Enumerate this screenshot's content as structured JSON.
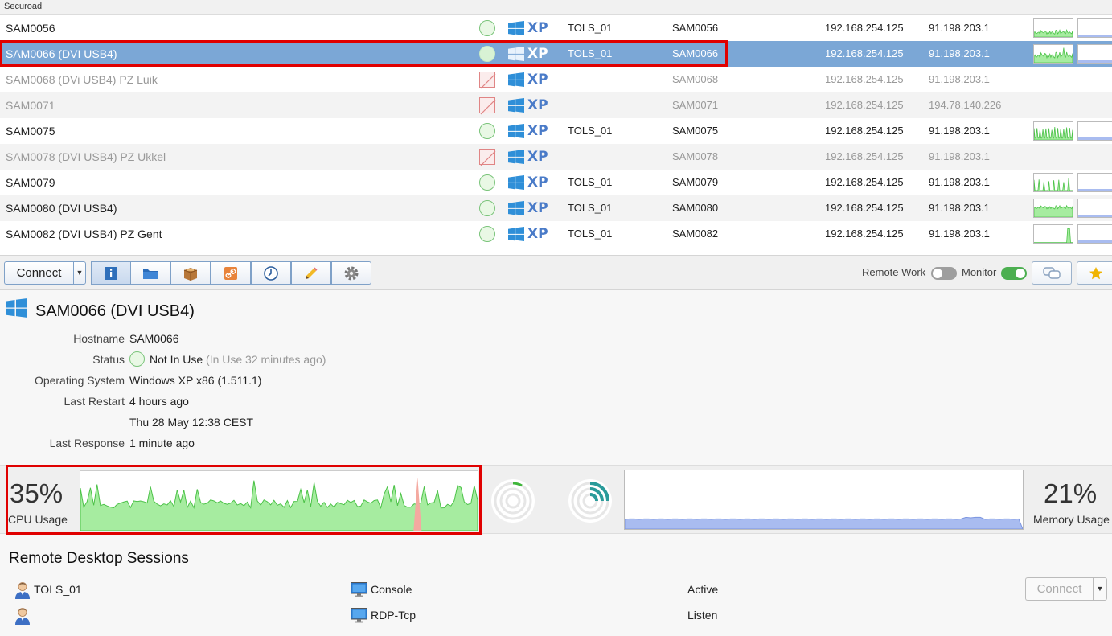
{
  "app": {
    "title": "Securoad"
  },
  "machines": [
    {
      "name": "SAM0056",
      "status": "online",
      "os": "XP",
      "user": "TOLS_01",
      "hostname": "SAM0056",
      "ip_local": "192.168.254.125",
      "ip_public": "91.198.203.1",
      "cpu_spark": "noisy-low"
    },
    {
      "name": "SAM0066 (DVI USB4)",
      "status": "online",
      "os": "XP",
      "user": "TOLS_01",
      "hostname": "SAM0066",
      "ip_local": "192.168.254.125",
      "ip_public": "91.198.203.1",
      "cpu_spark": "noisy-mid"
    },
    {
      "name": "SAM0068 (DVi USB4) PZ  Luik",
      "status": "offline",
      "os": "XP",
      "user": "",
      "hostname": "SAM0068",
      "ip_local": "192.168.254.125",
      "ip_public": "91.198.203.1",
      "cpu_spark": "none"
    },
    {
      "name": "SAM0071",
      "status": "offline",
      "os": "XP",
      "user": "",
      "hostname": "SAM0071",
      "ip_local": "192.168.254.125",
      "ip_public": "194.78.140.226",
      "cpu_spark": "none"
    },
    {
      "name": "SAM0075",
      "status": "online",
      "os": "XP",
      "user": "TOLS_01",
      "hostname": "SAM0075",
      "ip_local": "192.168.254.125",
      "ip_public": "91.198.203.1",
      "cpu_spark": "spiky"
    },
    {
      "name": "SAM0078 (DVI USB4) PZ  Ukkel",
      "status": "offline",
      "os": "XP",
      "user": "",
      "hostname": "SAM0078",
      "ip_local": "192.168.254.125",
      "ip_public": "91.198.203.1",
      "cpu_spark": "none"
    },
    {
      "name": "SAM0079",
      "status": "online",
      "os": "XP",
      "user": "TOLS_01",
      "hostname": "SAM0079",
      "ip_local": "192.168.254.125",
      "ip_public": "91.198.203.1",
      "cpu_spark": "sparse"
    },
    {
      "name": "SAM0080 (DVI USB4)",
      "status": "online",
      "os": "XP",
      "user": "TOLS_01",
      "hostname": "SAM0080",
      "ip_local": "192.168.254.125",
      "ip_public": "91.198.203.1",
      "cpu_spark": "dense"
    },
    {
      "name": "SAM0082 (DVI USB4) PZ Gent",
      "status": "online",
      "os": "XP",
      "user": "TOLS_01",
      "hostname": "SAM0082",
      "ip_local": "192.168.254.125",
      "ip_public": "91.198.203.1",
      "cpu_spark": "tail-spike"
    }
  ],
  "selected_machine_index": 1,
  "toolbar": {
    "connect_label": "Connect",
    "tool_icons": [
      "info-icon",
      "folder-icon",
      "package-icon",
      "link-icon",
      "clock-icon",
      "pencil-icon",
      "gear-icon"
    ],
    "remote_work_label": "Remote Work",
    "remote_work_on": false,
    "monitor_label": "Monitor",
    "monitor_on": true
  },
  "details": {
    "title": "SAM0066 (DVI USB4)",
    "hostname_label": "Hostname",
    "hostname": "SAM0066",
    "status_label": "Status",
    "status": "Not In Use",
    "status_hint": "(In Use 32 minutes ago)",
    "os_label": "Operating System",
    "os": "Windows XP x86 (1.511.1)",
    "restart_label": "Last Restart",
    "restart_relative": "4 hours ago",
    "restart_absolute": "Thu 28 May 12:38 CEST",
    "response_label": "Last Response",
    "response": "1 minute ago"
  },
  "performance": {
    "cpu_percent": "35%",
    "cpu_label": "CPU Usage",
    "memory_percent": "21%",
    "memory_label": "Memory Usage",
    "colors": {
      "cpu_fill": "#a6eca0",
      "cpu_line": "#4cc248",
      "cpu_alert": "#f4a9a0",
      "mem_fill": "#a9bcf0",
      "mem_line": "#7a94e0"
    }
  },
  "remote_desktop": {
    "title": "Remote Desktop Sessions",
    "connect_label": "Connect",
    "sessions": [
      {
        "user": "TOLS_01",
        "session": "Console",
        "state": "Active"
      },
      {
        "user": "",
        "session": "RDP-Tcp",
        "state": "Listen"
      }
    ]
  }
}
